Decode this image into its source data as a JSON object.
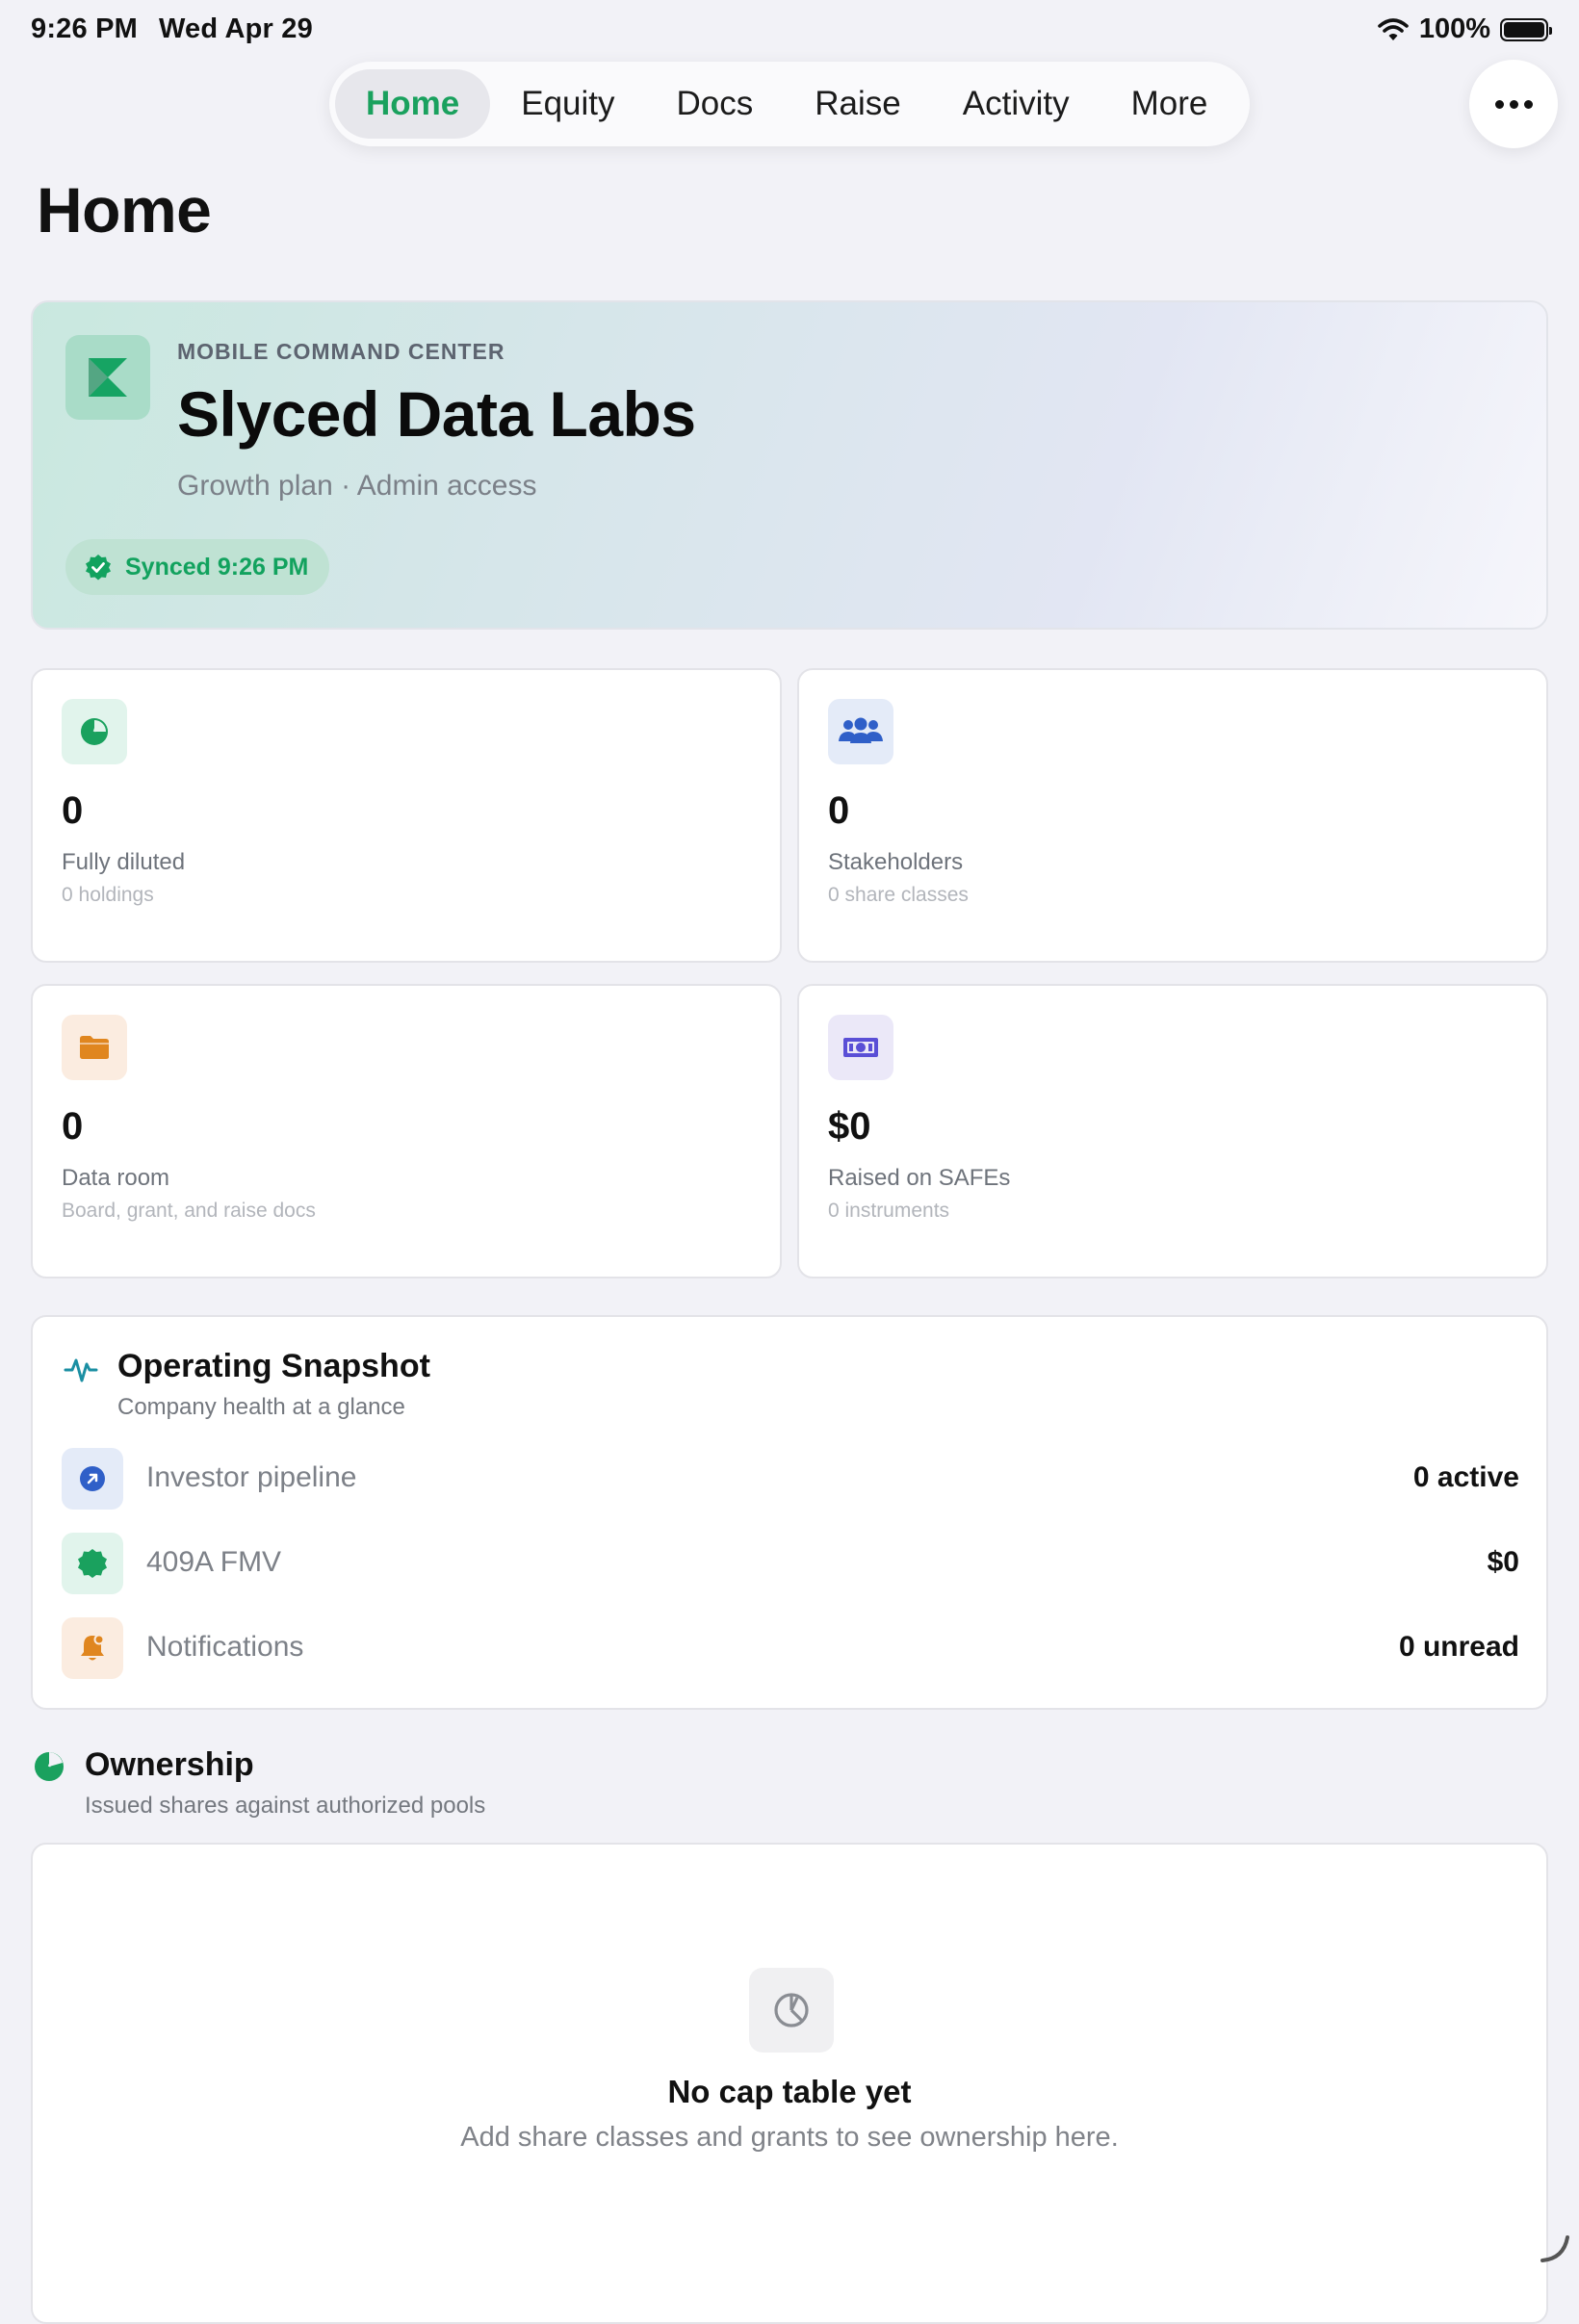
{
  "status_bar": {
    "time": "9:26 PM",
    "date": "Wed Apr 29",
    "battery": "100%"
  },
  "nav": {
    "tabs": [
      {
        "label": "Home"
      },
      {
        "label": "Equity"
      },
      {
        "label": "Docs"
      },
      {
        "label": "Raise"
      },
      {
        "label": "Activity"
      },
      {
        "label": "More"
      }
    ],
    "active_tab": "Home",
    "more_icon": "ellipsis-icon"
  },
  "page": {
    "title": "Home"
  },
  "hero": {
    "eyebrow": "MOBILE COMMAND CENTER",
    "company": "Slyced Data Labs",
    "subtitle": "Growth plan · Admin access",
    "sync_status": "Synced 9:26 PM"
  },
  "stats": [
    {
      "value": "0",
      "label": "Fully diluted",
      "sub": "0 holdings",
      "icon": "pie-chart-icon",
      "color": "#1aa15e",
      "bg": "#e1f4ec"
    },
    {
      "value": "0",
      "label": "Stakeholders",
      "sub": "0 share classes",
      "icon": "people-icon",
      "color": "#2f5fc8",
      "bg": "#e4ebf8"
    },
    {
      "value": "0",
      "label": "Data room",
      "sub": "Board, grant, and raise docs",
      "icon": "folder-icon",
      "color": "#e0861f",
      "bg": "#fbece0"
    },
    {
      "value": "$0",
      "label": "Raised on SAFEs",
      "sub": "0 instruments",
      "icon": "banknote-icon",
      "color": "#5a4fd6",
      "bg": "#ebe8f8"
    }
  ],
  "snapshot": {
    "title": "Operating Snapshot",
    "subtitle": "Company health at a glance",
    "rows": [
      {
        "label": "Investor pipeline",
        "value": "0 active",
        "icon": "arrow-up-right-circle-icon"
      },
      {
        "label": "409A FMV",
        "value": "$0",
        "icon": "seal-badge-icon"
      },
      {
        "label": "Notifications",
        "value": "0 unread",
        "icon": "bell-icon"
      }
    ]
  },
  "ownership": {
    "title": "Ownership",
    "subtitle": "Issued shares against authorized pools",
    "empty_title": "No cap table yet",
    "empty_subtitle": "Add share classes and grants to see ownership here."
  },
  "colors": {
    "accent": "#1aa15e",
    "background": "#f2f2f7"
  }
}
